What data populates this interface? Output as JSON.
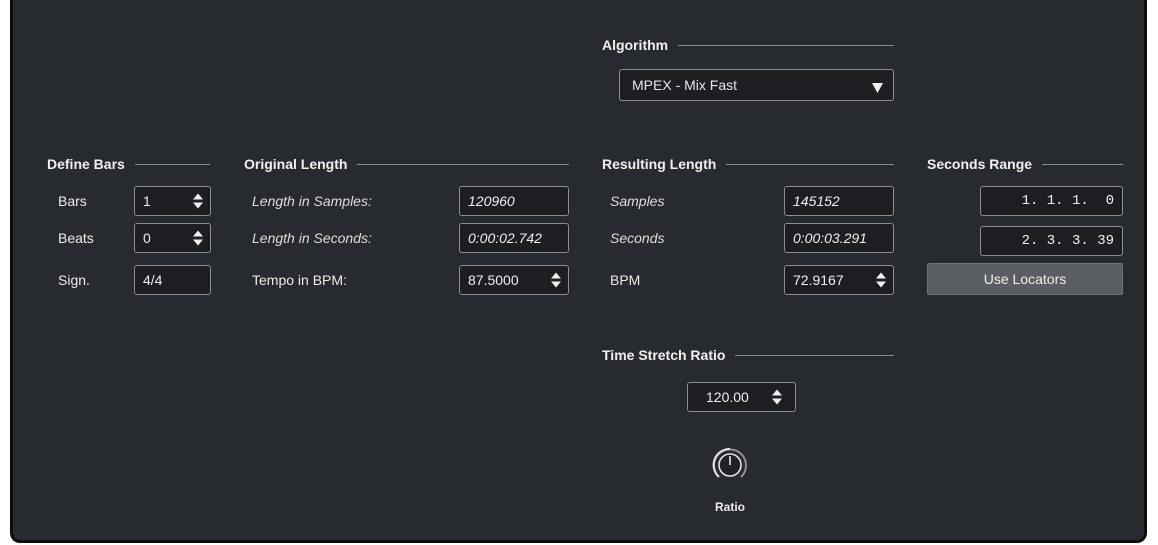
{
  "algorithm": {
    "heading": "Algorithm",
    "selected": "MPEX - Mix Fast"
  },
  "define_bars": {
    "heading": "Define Bars",
    "bars_label": "Bars",
    "bars_value": "1",
    "beats_label": "Beats",
    "beats_value": "0",
    "sign_label": "Sign.",
    "sign_value": "4/4"
  },
  "original_length": {
    "heading": "Original Length",
    "samples_label": "Length in Samples:",
    "samples_value": "120960",
    "seconds_label": "Length in Seconds:",
    "seconds_value": "0:00:02.742",
    "tempo_label": "Tempo in BPM:",
    "tempo_value": "87.5000"
  },
  "resulting_length": {
    "heading": "Resulting Length",
    "samples_label": "Samples",
    "samples_value": "145152",
    "seconds_label": "Seconds",
    "seconds_value": "0:00:03.291",
    "bpm_label": "BPM",
    "bpm_value": "72.9167"
  },
  "seconds_range": {
    "heading": "Seconds Range",
    "start_value": "1. 1. 1.  0",
    "end_value": "2. 3. 3. 39",
    "use_locators_label": "Use Locators"
  },
  "time_stretch": {
    "heading": "Time Stretch Ratio",
    "ratio_value": "120.00",
    "knob_label": "Ratio"
  },
  "icons": {
    "spinner": "up-down-arrows-icon",
    "dropdown": "triangle-down-icon",
    "knob": "rotary-knob-icon"
  },
  "colors": {
    "panel_bg": "#272a2e",
    "field_bg": "#1c1e21",
    "field_border": "#8b8e92",
    "button_bg": "#5a5d61"
  }
}
